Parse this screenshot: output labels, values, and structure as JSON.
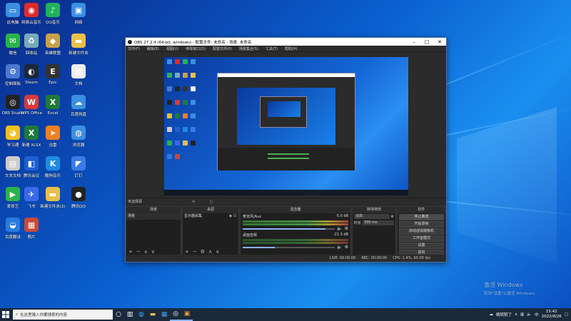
{
  "desktop": {
    "icons": [
      {
        "label": "此电脑",
        "color": "#3b8fe0",
        "glyph": "▭"
      },
      {
        "label": "网易云音乐",
        "color": "#e02a2a",
        "glyph": "◉"
      },
      {
        "label": "QQ音乐",
        "color": "#22b35a",
        "glyph": "♪"
      },
      {
        "label": "网络",
        "color": "#3b8fe0",
        "glyph": "▣"
      },
      {
        "label": "微信",
        "color": "#2ab34a",
        "glyph": "✉"
      },
      {
        "label": "回收站",
        "color": "#7ab",
        "glyph": "♻"
      },
      {
        "label": "英雄联盟",
        "color": "#c8a14a",
        "glyph": "◆"
      },
      {
        "label": "新建文件夹",
        "color": "#e8c04a",
        "glyph": "▬"
      },
      {
        "label": "控制面板",
        "color": "#4a7ad0",
        "glyph": "⚙"
      },
      {
        "label": "Steam",
        "color": "#1b2838",
        "glyph": "◐"
      },
      {
        "label": "Epic",
        "color": "#333",
        "glyph": "E"
      },
      {
        "label": "文档",
        "color": "#eee",
        "glyph": "▤"
      },
      {
        "label": "OBS Studio",
        "color": "#222",
        "glyph": "◎"
      },
      {
        "label": "WPS Office",
        "color": "#d83a3a",
        "glyph": "W"
      },
      {
        "label": "Excel",
        "color": "#1f7a3a",
        "glyph": "X"
      },
      {
        "label": "百度网盘",
        "color": "#3b8fe0",
        "glyph": "☁"
      },
      {
        "label": "学习通",
        "color": "#f0c020",
        "glyph": "◕"
      },
      {
        "label": "新建 XLSX",
        "color": "#1f7a3a",
        "glyph": "X"
      },
      {
        "label": "迅雷",
        "color": "#f08020",
        "glyph": "➤"
      },
      {
        "label": "浏览器",
        "color": "#3b8fe0",
        "glyph": "◍"
      },
      {
        "label": "文本文档",
        "color": "#ccc",
        "glyph": "▤"
      },
      {
        "label": "腾讯会议",
        "color": "#1f5fd0",
        "glyph": "◧"
      },
      {
        "label": "酷狗音乐",
        "color": "#1f8ae0",
        "glyph": "K"
      },
      {
        "label": "钉钉",
        "color": "#3b7ae8",
        "glyph": "◤"
      },
      {
        "label": "爱奇艺",
        "color": "#2ab34a",
        "glyph": "▶"
      },
      {
        "label": "飞书",
        "color": "#3b6ae8",
        "glyph": "✈"
      },
      {
        "label": "新建文件夹(2)",
        "color": "#e8c04a",
        "glyph": "▬"
      },
      {
        "label": "腾讯QQ",
        "color": "#222",
        "glyph": "●"
      },
      {
        "label": "百度翻译",
        "color": "#2a7ae0",
        "glyph": "◒"
      },
      {
        "label": "照片",
        "color": "#c84a3a",
        "glyph": "▦"
      }
    ],
    "watermark_title": "激活 Windows",
    "watermark_sub": "转到\"设置\"以激活 Windows。"
  },
  "obs": {
    "title": "OBS 27.2.4 (64-bit, windows) - 配置文件: 未命名 - 场景: 未命名",
    "menu": [
      "文件(F)",
      "编辑(E)",
      "视图(V)",
      "停靠窗口(D)",
      "配置文件(P)",
      "场景集合(S)",
      "工具(T)",
      "帮助(H)"
    ],
    "transition_bar": "未选择源",
    "scenes": {
      "header": "场景",
      "items": [
        "场景"
      ]
    },
    "sources": {
      "header": "来源",
      "items": [
        "显示器采集"
      ]
    },
    "mixer": {
      "header": "混音器",
      "channels": [
        {
          "name": "麦克风/Aux",
          "db": "-5.0 dB"
        },
        {
          "name": "桌面音频",
          "db": "-21.3 dB"
        }
      ]
    },
    "transitions": {
      "header": "转场特效",
      "type": "淡出",
      "duration_label": "时长",
      "duration": "300 ms"
    },
    "controls": {
      "header": "控件",
      "buttons": [
        "停止推流",
        "开始录制",
        "启动虚拟摄像机",
        "工作室模式",
        "设置",
        "退出"
      ]
    },
    "status": {
      "live": "LIVE: 00:00:00",
      "rec": "REC: 00:00:00",
      "cpu": "CPU: 1.4%, 60.00 fps"
    }
  },
  "taskbar": {
    "search_placeholder": "在这里输入你要搜索的内容",
    "tray_text": "晴转阴了",
    "time": "15:42",
    "date": "2022/8/26"
  }
}
